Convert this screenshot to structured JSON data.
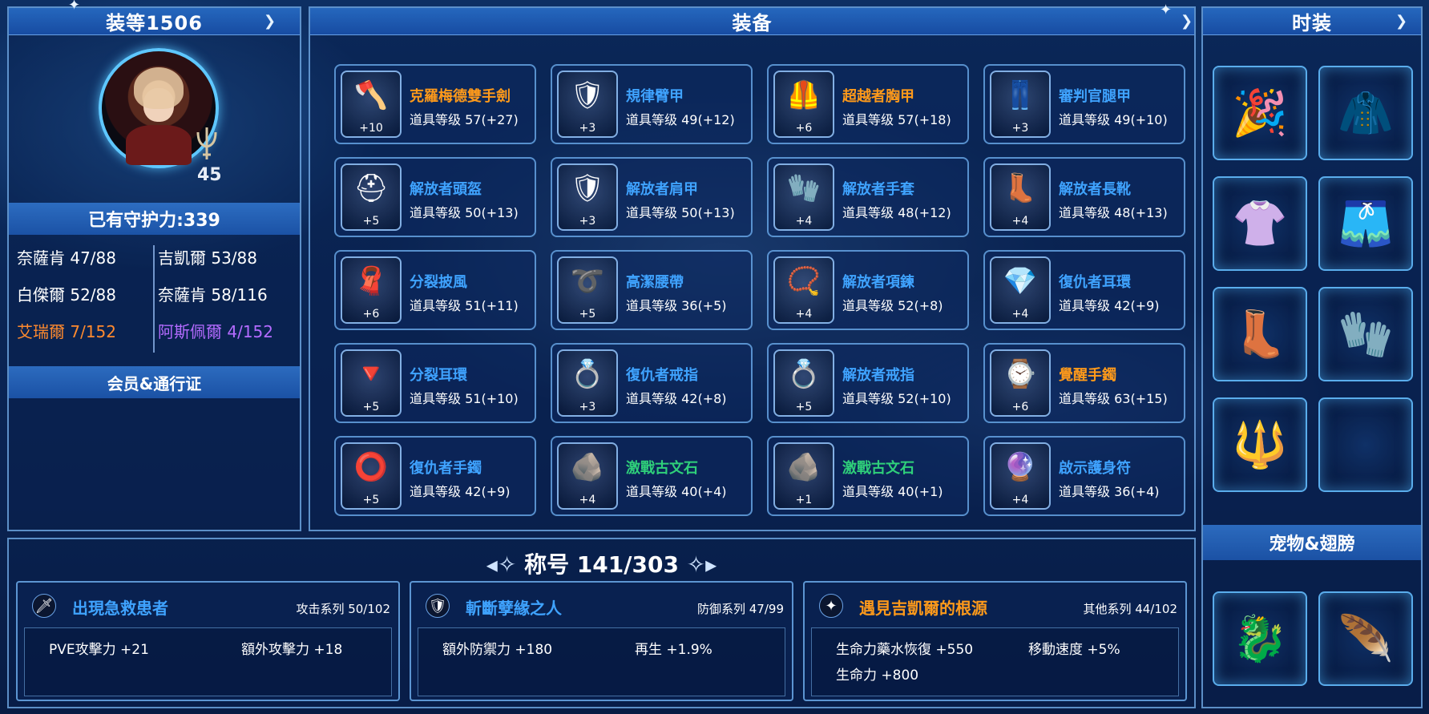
{
  "left_panel": {
    "title": "装等1506",
    "level": "45",
    "guard_power": "已有守护力:339",
    "stats": [
      {
        "label": "奈薩肯 47/88",
        "color": "white"
      },
      {
        "label": "吉凱爾 53/88",
        "color": "white"
      },
      {
        "label": "白傑爾 52/88",
        "color": "white"
      },
      {
        "label": "奈薩肯 58/116",
        "color": "white"
      },
      {
        "label": "艾瑞爾 7/152",
        "color": "#ff8a2e"
      },
      {
        "label": "阿斯佩爾 4/152",
        "color": "#b46bff"
      }
    ],
    "membership": "会员&通行证"
  },
  "equipment": {
    "title": "装备",
    "items": [
      {
        "name": "克羅梅德雙手劍",
        "level": "道具等级 57(+27)",
        "plus": "+10",
        "color": "#ff9a1a",
        "icon": "great-axe-icon",
        "glyph": "🪓"
      },
      {
        "name": "規律臂甲",
        "level": "道具等级 49(+12)",
        "plus": "+3",
        "color": "#3fa3ff",
        "icon": "pauldron-icon",
        "glyph": "🛡"
      },
      {
        "name": "超越者胸甲",
        "level": "道具等级 57(+18)",
        "plus": "+6",
        "color": "#ff9a1a",
        "icon": "chest-armor-icon",
        "glyph": "🦺"
      },
      {
        "name": "審判官腿甲",
        "level": "道具等级 49(+10)",
        "plus": "+3",
        "color": "#3fa3ff",
        "icon": "leg-armor-icon",
        "glyph": "👖"
      },
      {
        "name": "解放者頭盔",
        "level": "道具等级 50(+13)",
        "plus": "+5",
        "color": "#3fa3ff",
        "icon": "helmet-icon",
        "glyph": "⛑"
      },
      {
        "name": "解放者肩甲",
        "level": "道具等级 50(+13)",
        "plus": "+3",
        "color": "#3fa3ff",
        "icon": "shoulder-armor-icon",
        "glyph": "🛡"
      },
      {
        "name": "解放者手套",
        "level": "道具等级 48(+12)",
        "plus": "+4",
        "color": "#3fa3ff",
        "icon": "gauntlet-icon",
        "glyph": "🧤"
      },
      {
        "name": "解放者長靴",
        "level": "道具等级 48(+13)",
        "plus": "+4",
        "color": "#3fa3ff",
        "icon": "boots-icon",
        "glyph": "👢"
      },
      {
        "name": "分裂披風",
        "level": "道具等级 51(+11)",
        "plus": "+6",
        "color": "#3fa3ff",
        "icon": "cloak-icon",
        "glyph": "🧣"
      },
      {
        "name": "高潔腰帶",
        "level": "道具等级 36(+5)",
        "plus": "+5",
        "color": "#3fa3ff",
        "icon": "belt-icon",
        "glyph": "➰"
      },
      {
        "name": "解放者項鍊",
        "level": "道具等级 52(+8)",
        "plus": "+4",
        "color": "#3fa3ff",
        "icon": "necklace-icon",
        "glyph": "📿"
      },
      {
        "name": "復仇者耳環",
        "level": "道具等级 42(+9)",
        "plus": "+4",
        "color": "#3fa3ff",
        "icon": "earring-icon",
        "glyph": "💎"
      },
      {
        "name": "分裂耳環",
        "level": "道具等级 51(+10)",
        "plus": "+5",
        "color": "#3fa3ff",
        "icon": "earring-icon",
        "glyph": "🔻"
      },
      {
        "name": "復仇者戒指",
        "level": "道具等级 42(+8)",
        "plus": "+3",
        "color": "#3fa3ff",
        "icon": "ring-icon",
        "glyph": "💍"
      },
      {
        "name": "解放者戒指",
        "level": "道具等级 52(+10)",
        "plus": "+5",
        "color": "#3fa3ff",
        "icon": "ring-icon",
        "glyph": "💍"
      },
      {
        "name": "覺醒手鐲",
        "level": "道具等级 63(+15)",
        "plus": "+6",
        "color": "#ff9a1a",
        "icon": "bracelet-icon",
        "glyph": "⌚"
      },
      {
        "name": "復仇者手鐲",
        "level": "道具等级 42(+9)",
        "plus": "+5",
        "color": "#3fa3ff",
        "icon": "bracelet-icon",
        "glyph": "⭕"
      },
      {
        "name": "激戰古文石",
        "level": "道具等级 40(+4)",
        "plus": "+4",
        "color": "#2fd07a",
        "icon": "rune-stone-icon",
        "glyph": "🪨"
      },
      {
        "name": "激戰古文石",
        "level": "道具等级 40(+1)",
        "plus": "+1",
        "color": "#2fd07a",
        "icon": "rune-stone-icon",
        "glyph": "🪨"
      },
      {
        "name": "啟示護身符",
        "level": "道具等级 36(+4)",
        "plus": "+4",
        "color": "#3fa3ff",
        "icon": "amulet-icon",
        "glyph": "🔮"
      }
    ]
  },
  "fashion": {
    "title": "时装",
    "items": [
      {
        "icon": "party-hat-icon",
        "glyph": "🎉"
      },
      {
        "icon": "red-hood-icon",
        "glyph": "🧥"
      },
      {
        "icon": "black-top-icon",
        "glyph": "👚"
      },
      {
        "icon": "black-shorts-icon",
        "glyph": "🩳"
      },
      {
        "icon": "black-boots-icon",
        "glyph": "👢"
      },
      {
        "icon": "gold-glove-icon",
        "glyph": "🧤"
      },
      {
        "icon": "staff-icon",
        "glyph": "🔱"
      },
      {
        "icon": "empty-slot-icon",
        "glyph": ""
      }
    ],
    "pet_wing_label": "宠物&翅膀",
    "pet_wing_items": [
      {
        "icon": "fire-pet-icon",
        "glyph": "🐉"
      },
      {
        "icon": "purple-wings-icon",
        "glyph": "🪶"
      }
    ]
  },
  "titles": {
    "header": "称号 141/303",
    "cards": [
      {
        "name": "出現急救患者",
        "category": "攻击系列 50/102",
        "effects": [
          "PVE攻擊力 +21",
          "額外攻擊力 +18"
        ],
        "name_color": "#3fa3ff",
        "icon": "sword-icon",
        "glyph": "🗡"
      },
      {
        "name": "斬斷孽緣之人",
        "category": "防御系列 47/99",
        "effects": [
          "額外防禦力 +180",
          "再生 +1.9%"
        ],
        "name_color": "#3fa3ff",
        "icon": "shield-icon",
        "glyph": "🛡"
      },
      {
        "name": "遇見吉凱爾的根源",
        "category": "其他系列 44/102",
        "effects": [
          "生命力藥水恢復 +550",
          "移動速度 +5%",
          "生命力 +800"
        ],
        "name_color": "#ff9a1a",
        "icon": "star-icon",
        "glyph": "✦"
      }
    ]
  }
}
